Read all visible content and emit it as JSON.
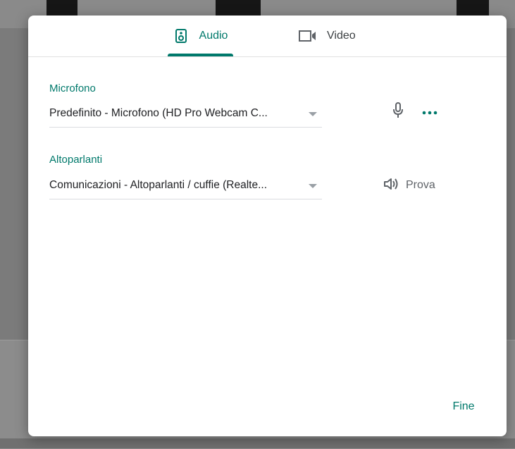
{
  "tabs": [
    {
      "label": "Audio",
      "icon": "speaker-icon",
      "active": true
    },
    {
      "label": "Video",
      "icon": "videocam-icon",
      "active": false
    }
  ],
  "microphone": {
    "label": "Microfono",
    "selected": "Predefinito - Microfono (HD Pro Webcam C...",
    "icon": "mic-icon",
    "more_icon": "more-horiz-icon"
  },
  "speakers": {
    "label": "Altoparlanti",
    "selected": "Comunicazioni - Altoparlanti / cuffie (Realte...",
    "test_label": "Prova",
    "test_icon": "volume-icon"
  },
  "done_label": "Fine",
  "colors": {
    "accent": "#00796b",
    "text": "#202124",
    "secondary": "#5f6368",
    "divider": "#dadce0"
  }
}
